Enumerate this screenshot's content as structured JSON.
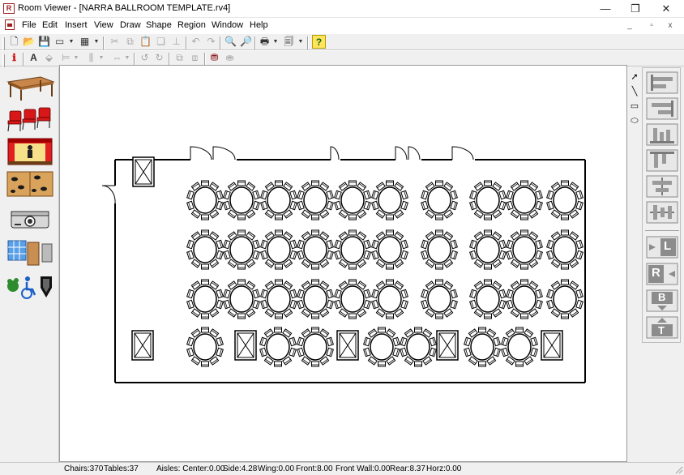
{
  "window": {
    "title": "Room Viewer - [NARRA BALLROOM TEMPLATE.rv4]",
    "app_icon": "room-viewer-app-icon",
    "controls": [
      "minimize-icon",
      "restore-icon",
      "close-icon"
    ],
    "control_glyphs": [
      "—",
      "❐",
      "✕"
    ]
  },
  "menu": {
    "items": [
      "File",
      "Edit",
      "Insert",
      "View",
      "Draw",
      "Shape",
      "Region",
      "Window",
      "Help"
    ]
  },
  "mdi_controls": [
    "_",
    "▫",
    "x"
  ],
  "toolbar1": {
    "buttons": [
      {
        "name": "new-icon",
        "glyph": "🗋",
        "enabled": true
      },
      {
        "name": "open-icon",
        "glyph": "📂",
        "enabled": true
      },
      {
        "name": "save-icon",
        "glyph": "💾",
        "enabled": true
      },
      {
        "name": "print-setup-icon",
        "glyph": "▭",
        "enabled": true,
        "dropdown": true
      },
      {
        "name": "table-grid-icon",
        "glyph": "▦",
        "enabled": true,
        "dropdown": true
      },
      {
        "name": "cut-icon",
        "glyph": "✂",
        "enabled": false
      },
      {
        "name": "copy-icon",
        "glyph": "⧉",
        "enabled": false
      },
      {
        "name": "paste-icon",
        "glyph": "📋",
        "enabled": false
      },
      {
        "name": "duplicate-icon",
        "glyph": "❏",
        "enabled": false
      },
      {
        "name": "anchor-icon",
        "glyph": "⊥",
        "enabled": false
      },
      {
        "name": "undo-icon",
        "glyph": "↶",
        "enabled": false
      },
      {
        "name": "redo-icon",
        "glyph": "↷",
        "enabled": false
      },
      {
        "name": "zoom-in-icon",
        "glyph": "🔍",
        "enabled": true
      },
      {
        "name": "zoom-out-icon",
        "glyph": "🔎",
        "enabled": true
      },
      {
        "name": "print-icon",
        "glyph": "🖶",
        "enabled": true,
        "dropdown": true
      },
      {
        "name": "print-preview-icon",
        "glyph": "🗐",
        "enabled": true,
        "dropdown": true
      },
      {
        "name": "help-icon",
        "glyph": "?",
        "enabled": true
      }
    ]
  },
  "toolbar2": {
    "buttons": [
      {
        "name": "info-icon",
        "glyph": "ℹ",
        "enabled": true
      },
      {
        "name": "text-icon",
        "glyph": "A",
        "enabled": true
      },
      {
        "name": "fill-icon",
        "glyph": "⬙",
        "enabled": false
      },
      {
        "name": "align-icon",
        "glyph": "⊨",
        "enabled": false,
        "dropdown": true
      },
      {
        "name": "distribute-icon",
        "glyph": "⫼",
        "enabled": false,
        "dropdown": true
      },
      {
        "name": "flip-icon",
        "glyph": "⇔",
        "enabled": false,
        "dropdown": true
      },
      {
        "name": "rotate-left-icon",
        "glyph": "↺",
        "enabled": false
      },
      {
        "name": "rotate-right-icon",
        "glyph": "↻",
        "enabled": false
      },
      {
        "name": "bring-front-icon",
        "glyph": "⧉",
        "enabled": false
      },
      {
        "name": "send-back-icon",
        "glyph": "⧈",
        "enabled": false
      },
      {
        "name": "group-icon",
        "glyph": "⛃",
        "enabled": true
      },
      {
        "name": "ungroup-icon",
        "glyph": "⛂",
        "enabled": false
      }
    ]
  },
  "left_palette": {
    "items": [
      "table-icon",
      "chairs-icon",
      "stage-icon",
      "dance-floor-icon",
      "projector-icon",
      "room-divider-icon",
      "decor-accessibility-icon"
    ]
  },
  "draw_tools": {
    "items": [
      {
        "name": "pointer-tool-icon",
        "glyph": "➚"
      },
      {
        "name": "line-tool-icon",
        "glyph": "╲"
      },
      {
        "name": "rectangle-tool-icon",
        "glyph": "▭"
      },
      {
        "name": "ellipse-tool-icon",
        "glyph": "⬭"
      }
    ]
  },
  "right_palette": {
    "items": [
      "align-left-icon",
      "align-right-icon",
      "align-bottom-icon",
      "align-top-icon",
      "align-center-horizontal-icon",
      "align-center-vertical-icon"
    ],
    "letter_buttons": [
      {
        "name": "layout-left-button",
        "letter": "L"
      },
      {
        "name": "layout-right-button",
        "letter": "R"
      },
      {
        "name": "layout-bottom-button",
        "letter": "B"
      },
      {
        "name": "layout-top-button",
        "letter": "T"
      }
    ]
  },
  "floorplan": {
    "round_table_rows": [
      {
        "tables": 10,
        "seats_per_table": 10
      },
      {
        "tables": 10,
        "seats_per_table": 10
      },
      {
        "tables": 10,
        "seats_per_table": 10
      },
      {
        "tables": 7,
        "seats_per_table": 10
      }
    ],
    "pillars": 7,
    "doors": 6
  },
  "status": {
    "chairs": "Chairs:370",
    "tables": "Tables:37",
    "aisles": "Aisles: Center:0.00",
    "side": "Side:4.28",
    "wing": "Wing:0.00",
    "front": "Front:8.00",
    "front_wall": "Front Wall:0.00",
    "rear": "Rear:8.37",
    "horz": "Horz:0.00"
  }
}
